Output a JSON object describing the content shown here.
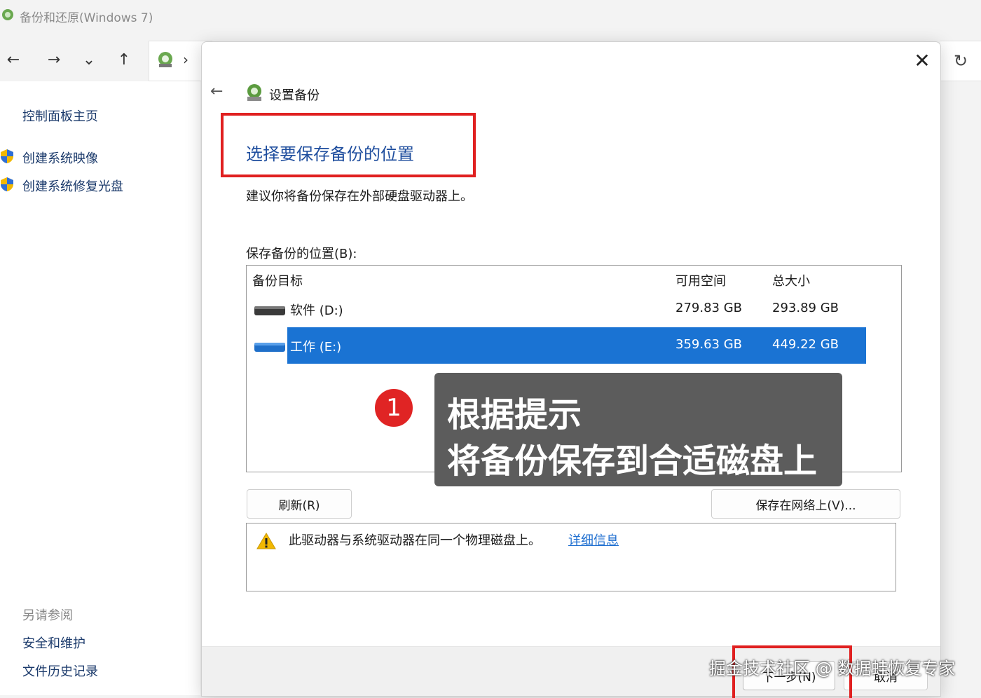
{
  "window": {
    "title": "备份和还原(Windows 7)",
    "nav": {
      "back_icon": "←",
      "forward_icon": "→",
      "dropdown_icon": "⌄",
      "up_icon": "↑",
      "breadcrumb_sep": "›",
      "refresh_icon": "↻"
    }
  },
  "sidebar": {
    "home": "控制面板主页",
    "items": [
      {
        "label": "创建系统映像"
      },
      {
        "label": "创建系统修复光盘"
      }
    ],
    "see_also": "另请参阅",
    "links": [
      {
        "label": "安全和维护"
      },
      {
        "label": "文件历史记录"
      }
    ]
  },
  "dialog": {
    "close_icon": "✕",
    "back_icon": "←",
    "title": "设置备份",
    "heading": "选择要保存备份的位置",
    "hint": "建议你将备份保存在外部硬盘驱动器上。",
    "location_label": "保存备份的位置(B):",
    "table": {
      "headers": {
        "target": "备份目标",
        "free": "可用空间",
        "total": "总大小"
      },
      "rows": [
        {
          "name": "软件 (D:)",
          "free": "279.83 GB",
          "total": "293.89 GB",
          "selected": false
        },
        {
          "name": "工作 (E:)",
          "free": "359.63 GB",
          "total": "449.22 GB",
          "selected": true
        }
      ]
    },
    "refresh_button": "刷新(R)",
    "save_network_button": "保存在网络上(V)...",
    "warning": {
      "text": "此驱动器与系统驱动器在同一个物理磁盘上。",
      "link": "详细信息"
    },
    "footer": {
      "next_button": "下一步(N)",
      "cancel_button": "取消"
    }
  },
  "annotation": {
    "step": "1",
    "lines": [
      "根据提示",
      "将备份保存到合适磁盘上"
    ]
  },
  "watermark": "掘金技术社区 @ 数据蛙恢复专家",
  "colors": {
    "highlight": "#e02020",
    "selection": "#1a73d3",
    "heading": "#1f4e9e",
    "link": "#1f6fd0"
  }
}
